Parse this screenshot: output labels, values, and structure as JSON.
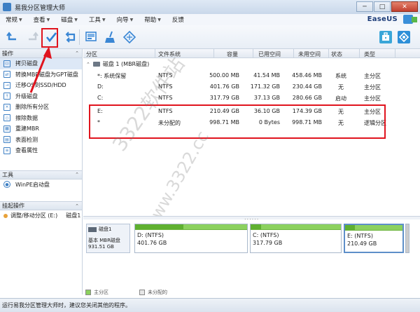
{
  "window": {
    "title": "易我分区管理大师",
    "minimize": "─",
    "maximize": "□",
    "close": "✕"
  },
  "menus": [
    {
      "label": "常规"
    },
    {
      "label": "查看"
    },
    {
      "label": "磁盘"
    },
    {
      "label": "工具"
    },
    {
      "label": "向导"
    },
    {
      "label": "帮助"
    },
    {
      "label": "反馈"
    }
  ],
  "brand": "EaseUS",
  "toolbar": {
    "undo_icon": "undo-icon",
    "redo_icon": "redo-icon",
    "apply_icon": "check-icon",
    "refresh_icon": "refresh-icon",
    "disk_view_icon": "disk-view-icon",
    "cleanup_icon": "broom-icon",
    "optimize_icon": "diamond-icon",
    "toolkit_icon": "toolkit-icon",
    "settings_icon": "settings-icon"
  },
  "sidebar": {
    "operations_title": "操作",
    "operations": [
      {
        "label": "拷贝磁盘",
        "icon": "copy-disk-icon"
      },
      {
        "label": "转换MBR磁盘为GPT磁盘",
        "icon": "convert-icon"
      },
      {
        "label": "迁移OS到SSD/HDD",
        "icon": "migrate-icon"
      },
      {
        "label": "升级磁盘",
        "icon": "upgrade-icon"
      },
      {
        "label": "删除所有分区",
        "icon": "delete-all-icon"
      },
      {
        "label": "擦除数据",
        "icon": "wipe-icon"
      },
      {
        "label": "重建MBR",
        "icon": "rebuild-mbr-icon"
      },
      {
        "label": "表面检测",
        "icon": "surface-test-icon"
      },
      {
        "label": "查看属性",
        "icon": "properties-icon"
      }
    ],
    "tools_title": "工具",
    "tools": [
      {
        "label": "WinPE启动盘",
        "icon": "winpe-icon"
      }
    ],
    "pending_title": "挂起操作",
    "pending": [
      {
        "label": "调整/移动分区 (E:)",
        "disk": "磁盘1"
      }
    ]
  },
  "table": {
    "headers": [
      "分区",
      "文件系统",
      "容量",
      "已用空间",
      "未用空间",
      "状态",
      "类型"
    ],
    "disk_label": "磁盘 1 (MBR磁盘)",
    "rows": [
      {
        "part": "*: 系统保留",
        "fs": "NTFS",
        "cap": "500.00 MB",
        "used": "41.54 MB",
        "free": "458.46 MB",
        "status": "系统",
        "type": "主分区"
      },
      {
        "part": "D:",
        "fs": "NTFS",
        "cap": "401.76 GB",
        "used": "171.32 GB",
        "free": "230.44 GB",
        "status": "无",
        "type": "主分区"
      },
      {
        "part": "C:",
        "fs": "NTFS",
        "cap": "317.79 GB",
        "used": "37.13 GB",
        "free": "280.66 GB",
        "status": "启动",
        "type": "主分区"
      },
      {
        "part": "E:",
        "fs": "NTFS",
        "cap": "210.49 GB",
        "used": "36.10 GB",
        "free": "174.39 GB",
        "status": "无",
        "type": "主分区"
      },
      {
        "part": "*",
        "fs": "未分配的",
        "cap": "998.71 MB",
        "used": "0 Bytes",
        "free": "998.71 MB",
        "status": "无",
        "type": "逻辑分区"
      }
    ]
  },
  "watermark": "3322软件站",
  "watermark2": "www.3322.cc",
  "diskmap": {
    "disk_name": "磁盘1",
    "disk_type": "基本 MBR磁盘",
    "disk_size": "931.51 GB",
    "partitions": [
      {
        "name": "D: (NTFS)",
        "size": "401.76 GB",
        "used_fraction": 0.43
      },
      {
        "name": "C: (NTFS)",
        "size": "317.79 GB",
        "used_fraction": 0.12
      },
      {
        "name": "E: (NTFS)",
        "size": "210.49 GB",
        "used_fraction": 0.17
      }
    ],
    "splitter": "......"
  },
  "legend": {
    "primary": "主分区",
    "unallocated": "未分配的",
    "primary_color": "#8cd15e",
    "unallocated_color": "#e6e6e6"
  },
  "status_text": "运行易我分区管理大师时，建议您关闭其他的程序。"
}
